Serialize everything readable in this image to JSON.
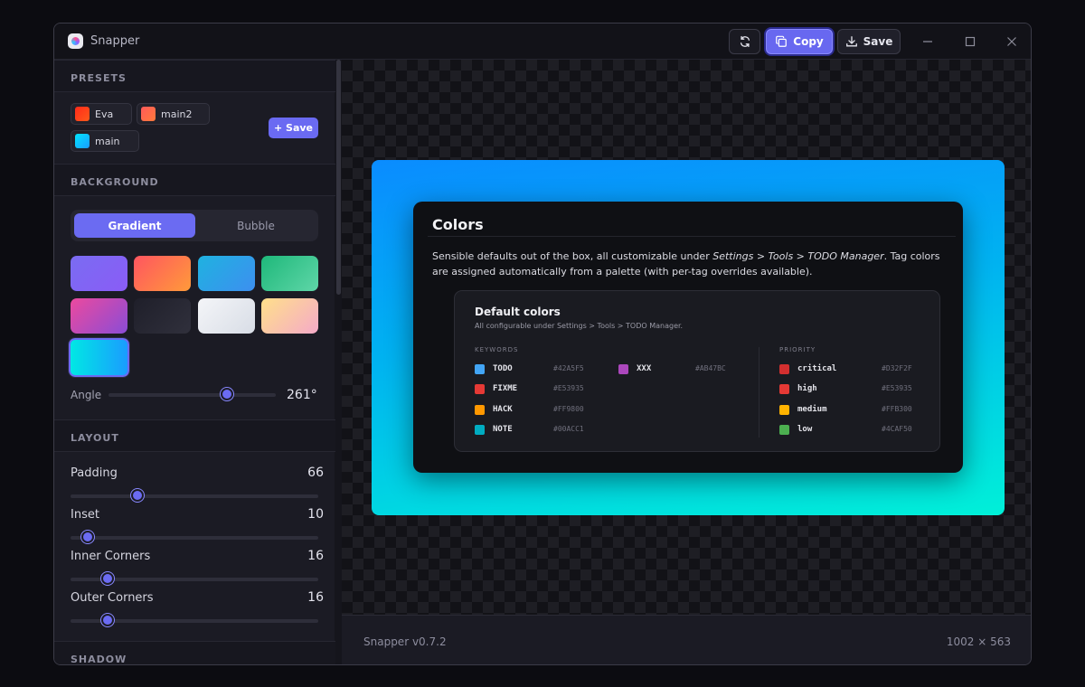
{
  "window": {
    "title": "Snapper"
  },
  "toolbar": {
    "copy_label": "Copy",
    "save_label": "Save"
  },
  "sidebar": {
    "presets": {
      "heading": "PRESETS",
      "items": [
        {
          "label": "Eva",
          "color": "#ff3a1a"
        },
        {
          "label": "main2",
          "color": "#ff6a5a"
        },
        {
          "label": "main",
          "color": "#1fd3e8"
        }
      ],
      "save_label": "+ Save"
    },
    "background": {
      "heading": "BACKGROUND",
      "modes": [
        "Gradient",
        "Bubble"
      ],
      "active_mode": "Gradient",
      "swatches": [
        "violet-gradient",
        "coral-gradient",
        "sky-gradient",
        "mint-gradient",
        "magenta-gradient",
        "charcoal-gradient",
        "frost-gradient",
        "peach-gradient",
        "aqua-gradient"
      ],
      "selected_swatch": 8,
      "angle_label": "Angle",
      "angle_value": "261°",
      "angle_fraction": 0.71
    },
    "layout": {
      "heading": "LAYOUT",
      "sliders": [
        {
          "label": "Padding",
          "value": "66",
          "fraction": 0.27
        },
        {
          "label": "Inset",
          "value": "10",
          "fraction": 0.07
        },
        {
          "label": "Inner Corners",
          "value": "16",
          "fraction": 0.15
        },
        {
          "label": "Outer Corners",
          "value": "16",
          "fraction": 0.15
        }
      ]
    },
    "shadow": {
      "heading": "SHADOW"
    }
  },
  "preview": {
    "card_title": "Colors",
    "description_parts": [
      "Sensible defaults out of the box, all customizable under ",
      "Settings > Tools > TODO Manager",
      ". Tag colors are assigned automatically from a palette (with per-tag overrides available)."
    ],
    "inner": {
      "title": "Default colors",
      "subtitle": "All configurable under Settings > Tools > TODO Manager.",
      "keywords_caption": "KEYWORDS",
      "priority_caption": "PRIORITY",
      "keywords": [
        {
          "name": "TODO",
          "hex": "#42A5F5"
        },
        {
          "name": "FIXME",
          "hex": "#E53935"
        },
        {
          "name": "HACK",
          "hex": "#FF9800"
        },
        {
          "name": "NOTE",
          "hex": "#00ACC1"
        },
        {
          "name": "XXX",
          "hex": "#AB47BC"
        }
      ],
      "priorities": [
        {
          "name": "critical",
          "hex": "#D32F2F"
        },
        {
          "name": "high",
          "hex": "#E53935"
        },
        {
          "name": "medium",
          "hex": "#FFB300"
        },
        {
          "name": "low",
          "hex": "#4CAF50"
        }
      ]
    }
  },
  "status": {
    "version": "Snapper v0.7.2",
    "dimensions": "1002 × 563"
  },
  "colors": {
    "accent": "#6b6bf2"
  }
}
